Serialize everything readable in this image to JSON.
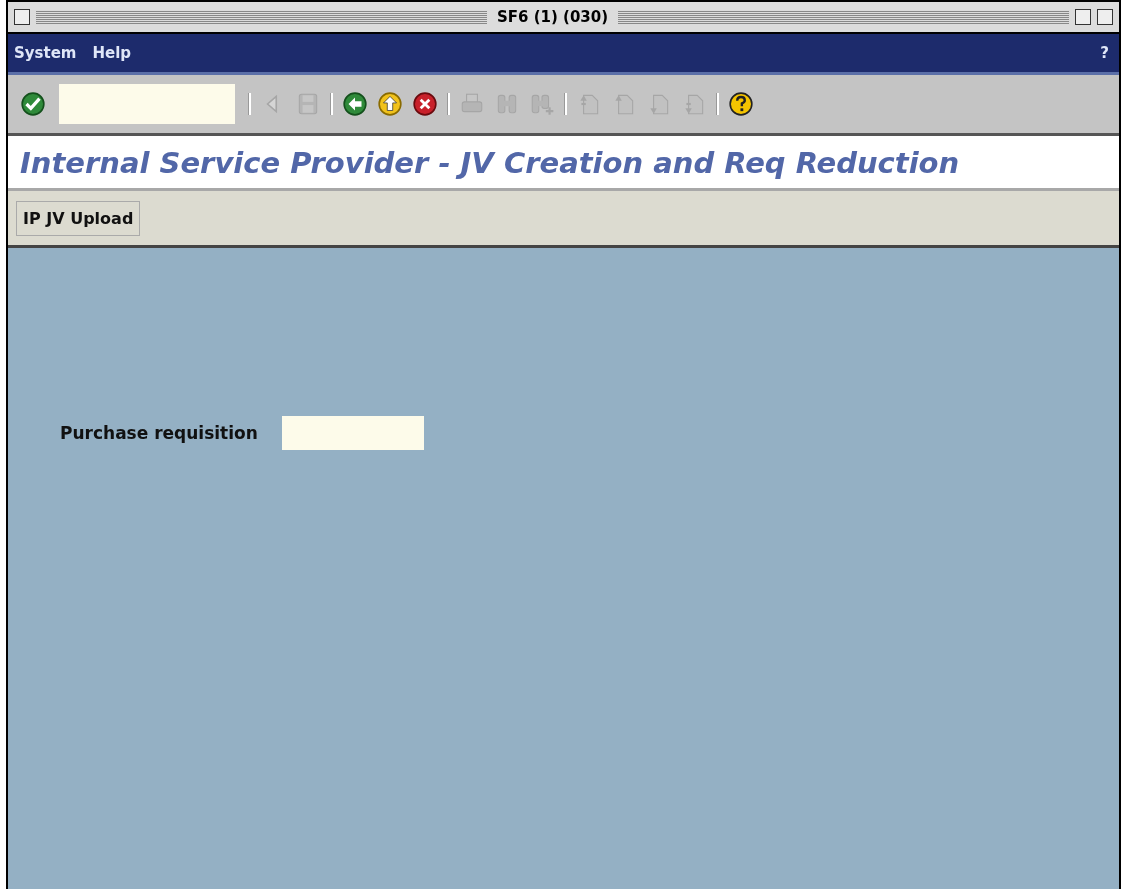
{
  "window": {
    "title": "SF6 (1) (030)"
  },
  "menu": [
    {
      "label": "System"
    },
    {
      "label": "Help"
    }
  ],
  "menu_help_mark": "?",
  "toolbar": {
    "items": [
      {
        "kind": "enter",
        "disabled": false
      },
      {
        "kind": "command_field"
      },
      {
        "kind": "separator"
      },
      {
        "kind": "prev",
        "disabled": true
      },
      {
        "kind": "save",
        "disabled": true
      },
      {
        "kind": "separator"
      },
      {
        "kind": "back",
        "disabled": false
      },
      {
        "kind": "exit",
        "disabled": false
      },
      {
        "kind": "cancel",
        "disabled": false
      },
      {
        "kind": "separator"
      },
      {
        "kind": "print",
        "disabled": true
      },
      {
        "kind": "find",
        "disabled": true
      },
      {
        "kind": "find_next",
        "disabled": true
      },
      {
        "kind": "separator"
      },
      {
        "kind": "first_page",
        "disabled": true
      },
      {
        "kind": "prev_page",
        "disabled": true
      },
      {
        "kind": "next_page",
        "disabled": true
      },
      {
        "kind": "last_page",
        "disabled": true
      },
      {
        "kind": "separator"
      },
      {
        "kind": "help",
        "disabled": false
      }
    ]
  },
  "screen_title": "Internal Service Provider - JV Creation and Req Reduction",
  "app_toolbar": [
    {
      "label": "IP JV Upload"
    }
  ],
  "fields": [
    {
      "label": "Purchase requisition"
    }
  ]
}
